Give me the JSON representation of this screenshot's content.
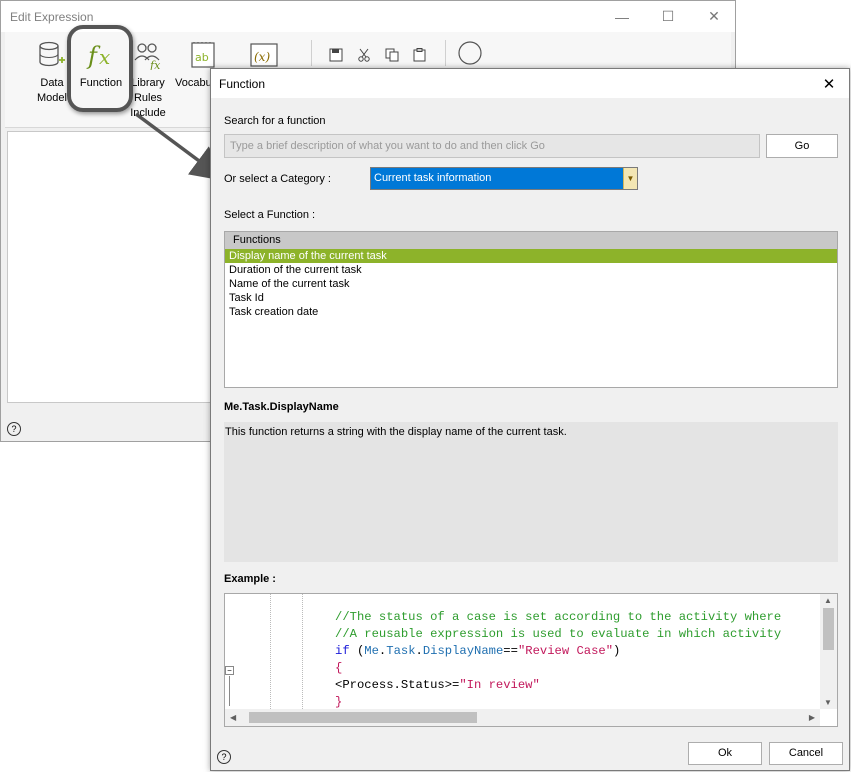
{
  "background_window": {
    "title": "Edit Expression",
    "minimize_glyph": "—",
    "maximize_glyph": "☐",
    "close_glyph": "✕",
    "ribbon": [
      {
        "label": "Data\nModel",
        "icon": "database-icon"
      },
      {
        "label": "Function",
        "icon": "function-fx-icon"
      },
      {
        "label": "Library\nRules\nInclude",
        "icon": "library-rules-icon"
      },
      {
        "label": "Vocabu",
        "icon": "vocabulary-icon"
      },
      {
        "label": "",
        "icon": "variable-icon"
      }
    ],
    "help_glyph": "?"
  },
  "dialog": {
    "title": "Function",
    "close_glyph": "✕",
    "search_label": "Search for a function",
    "search_placeholder": "Type a brief description of what you want to do and then click Go",
    "go_button": "Go",
    "category_label": "Or select a Category :",
    "category_value": "Current task information",
    "select_function_label": "Select a Function :",
    "functions_header": "Functions",
    "functions": [
      "Display name of the current task",
      "Duration of the current task",
      "Name of the current task",
      "Task Id",
      "Task creation date"
    ],
    "selected_function_index": 0,
    "function_name": "Me.Task.DisplayName",
    "description": "This function returns a string with the display name of the current task.",
    "example_label": "Example :",
    "example_lines": [
      "//The status of a case is set according to the activity where",
      "//A reusable expression is used to evaluate in which activity",
      "if (Me.Task.DisplayName==\"Review Case\")",
      "{",
      "<Process.Status>=\"In review\"",
      "}"
    ],
    "ok_button": "Ok",
    "cancel_button": "Cancel",
    "help_glyph": "?"
  },
  "colors": {
    "selection_blue": "#0078d7",
    "selected_function_green": "#8db32a",
    "comment_green": "#2e9d2e",
    "keyword_blue": "#1a1ad8",
    "string_color": "#c2185b"
  }
}
